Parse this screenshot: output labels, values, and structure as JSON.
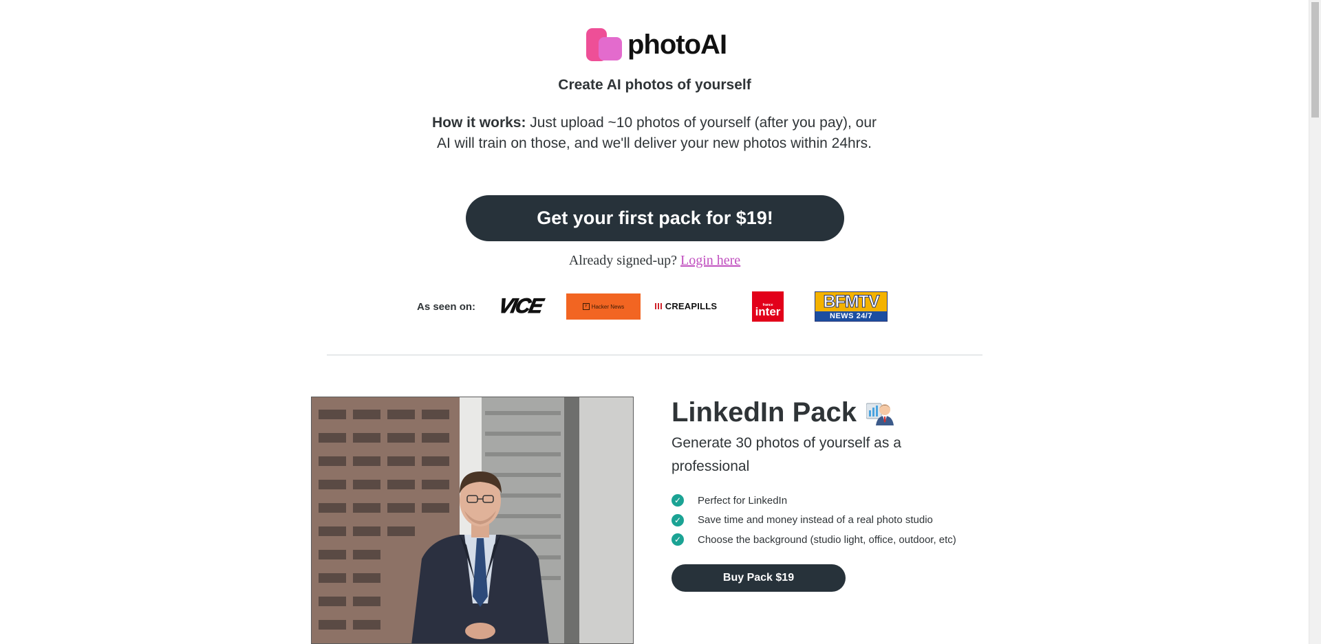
{
  "brand": {
    "name": "photoAI",
    "colors": {
      "logo_primary": "#ee4f97",
      "logo_secondary": "#e36bcd"
    }
  },
  "hero": {
    "tagline": "Create AI photos of yourself",
    "how_label": "How it works:",
    "how_text": " Just upload ~10 photos of yourself (after you pay), our AI will train on those, and we'll deliver your new photos within 24hrs.",
    "cta_label": "Get your first pack for $19!",
    "signed_text": "Already signed-up? ",
    "login_link": "Login here"
  },
  "press": {
    "label": "As seen on:",
    "outlets": [
      {
        "name": "VICE",
        "icon": "vice-logo"
      },
      {
        "name": "Hacker News",
        "icon": "hacker-news-logo"
      },
      {
        "name": "CREAPILLS",
        "icon": "creapills-logo"
      },
      {
        "name": "inter",
        "sub": "france",
        "icon": "france-inter-logo"
      },
      {
        "name": "BFMTV",
        "sub": "NEWS 24/7",
        "icon": "bfmtv-logo"
      }
    ]
  },
  "pack": {
    "title": "LinkedIn Pack",
    "emoji_icon": "office-worker-emoji",
    "subtitle": "Generate 30 photos of yourself as a professional",
    "features": [
      "Perfect for LinkedIn",
      "Save time and money instead of a real photo studio",
      "Choose the background (studio light, office, outdoor, etc)"
    ],
    "buy_label": "Buy Pack $19",
    "accent_color": "#1ba394",
    "image_icon": "professional-portrait-photo"
  }
}
